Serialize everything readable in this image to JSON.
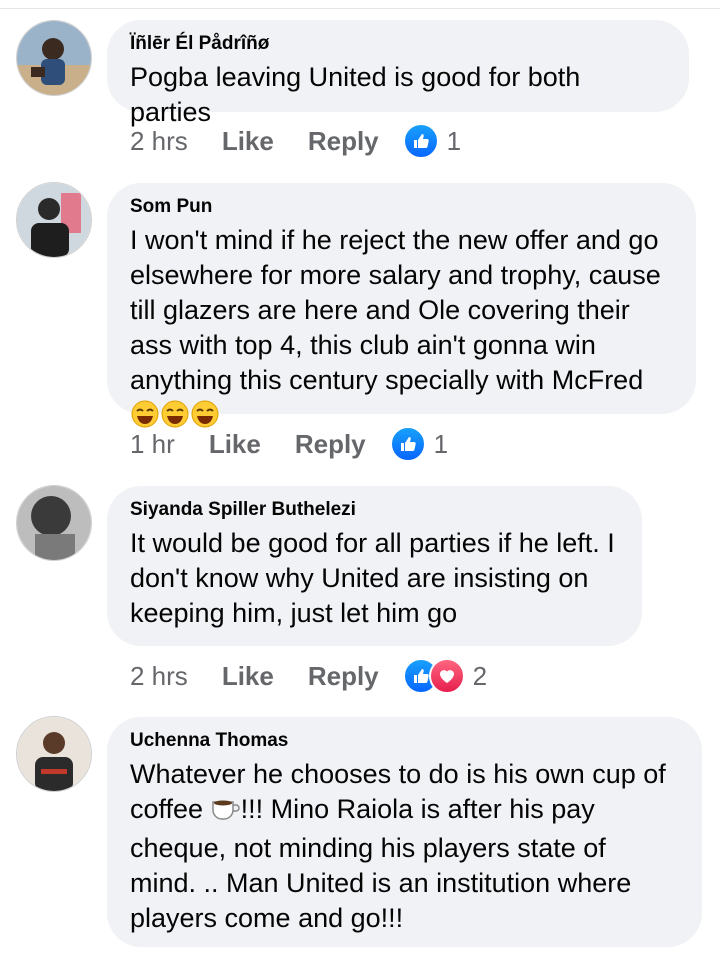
{
  "comments": [
    {
      "author": "Ïñlēr Él Pådrîñø",
      "text": "Pogba leaving United is good for both parties",
      "time": "2 hrs",
      "like": "Like",
      "reply": "Reply",
      "count": "1"
    },
    {
      "author": "Som Pun",
      "text": "I won't mind if he reject the new offer and go elsewhere for more salary and trophy, cause till glazers are here and Ole covering their ass with top 4, this club ain't gonna win anything this century specially with McFred",
      "time": "1 hr",
      "like": "Like",
      "reply": "Reply",
      "count": "1"
    },
    {
      "author": "Siyanda Spiller Buthelezi",
      "text": "It would be good for all parties if he left. I don't know why United are insisting on keeping him, just let him go",
      "time": "2 hrs",
      "like": "Like",
      "reply": "Reply",
      "count": "2"
    },
    {
      "author": "Uchenna Thomas",
      "text_part1": "Whatever he chooses to do is his own cup of coffee",
      "text_part2": "!!! Mino Raiola is after his pay cheque, not minding his players state of mind. .. Man United is an institution where players come and go!!!"
    }
  ],
  "colors": {
    "like": "#0866ff",
    "love": "#e61e4d",
    "bubble": "#f0f2f5",
    "meta": "#65676b"
  },
  "icons": [
    "like-reaction-icon",
    "love-reaction-icon",
    "laughing-emoji-icon",
    "coffee-emoji-icon"
  ]
}
